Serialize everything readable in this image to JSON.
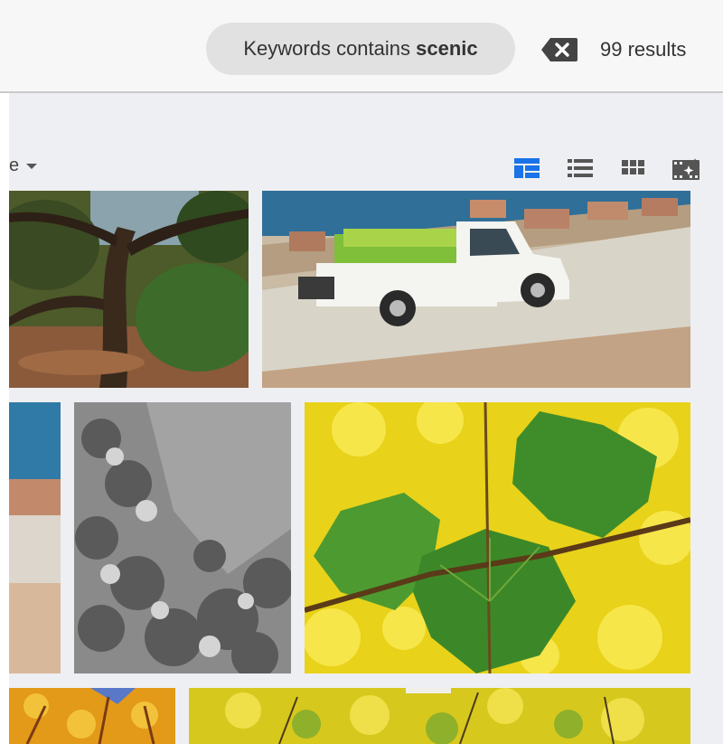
{
  "filter": {
    "chip_prefix": "Keywords contains ",
    "chip_keyword": "scenic",
    "clear_icon": "backspace-icon",
    "results_text": "99 results"
  },
  "toolbar": {
    "sort_label_fragment": "e",
    "sort_caret_icon": "caret-down-icon",
    "views": [
      {
        "name": "mosaic-view",
        "icon": "mosaic-grid-icon",
        "active": true
      },
      {
        "name": "list-view",
        "icon": "list-icon",
        "active": false
      },
      {
        "name": "grid-view",
        "icon": "grid-icon",
        "active": false
      },
      {
        "name": "slideshow-view",
        "icon": "film-spark-icon",
        "active": false
      }
    ]
  },
  "colors": {
    "active_view": "#1a73e8",
    "inactive_view": "#555555",
    "chip_bg": "#e1e1e1",
    "gallery_bg": "#eeeff2"
  },
  "gallery": {
    "tiles": [
      {
        "subject": "pine-tree-seaside"
      },
      {
        "subject": "white-pickup-truck-seaside-road"
      },
      {
        "subject": "seaside-beach-partial"
      },
      {
        "subject": "grayscale-foliage"
      },
      {
        "subject": "green-yellow-maple-leaves"
      },
      {
        "subject": "orange-autumn-tree"
      },
      {
        "subject": "yellow-autumn-tree"
      }
    ]
  }
}
